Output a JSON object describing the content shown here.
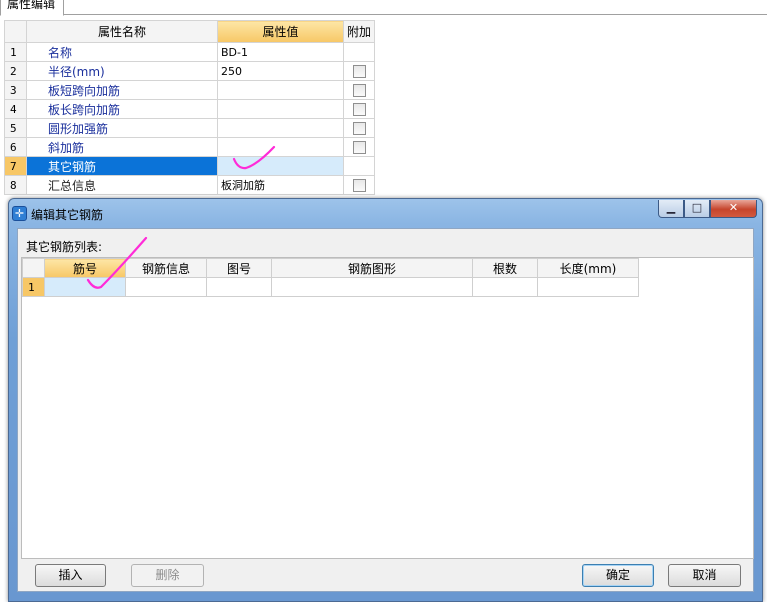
{
  "panel": {
    "tab_label": "属性编辑",
    "columns": {
      "name": "属性名称",
      "value": "属性值",
      "extra": "附加"
    },
    "rows": [
      {
        "num": "1",
        "name": "名称",
        "value": "BD-1",
        "has_check": false
      },
      {
        "num": "2",
        "name": "半径(mm)",
        "value": "250",
        "has_check": true
      },
      {
        "num": "3",
        "name": "板短跨向加筋",
        "value": "",
        "has_check": true
      },
      {
        "num": "4",
        "name": "板长跨向加筋",
        "value": "",
        "has_check": true
      },
      {
        "num": "5",
        "name": "圆形加强筋",
        "value": "",
        "has_check": true
      },
      {
        "num": "6",
        "name": "斜加筋",
        "value": "",
        "has_check": true
      },
      {
        "num": "7",
        "name": "其它钢筋",
        "value": "",
        "has_check": false,
        "selected": true
      },
      {
        "num": "8",
        "name": "汇总信息",
        "value": "板洞加筋",
        "has_check": true
      }
    ]
  },
  "dialog": {
    "title": "编辑其它钢筋",
    "list_label": "其它钢筋列表:",
    "columns": [
      "筋号",
      "钢筋信息",
      "图号",
      "钢筋图形",
      "根数",
      "长度(mm)"
    ],
    "rows": [
      {
        "num": "1",
        "cells": [
          "",
          "",
          "",
          "",
          "",
          ""
        ]
      }
    ],
    "buttons": {
      "insert": "插入",
      "delete": "删除",
      "ok": "确定",
      "cancel": "取消"
    },
    "window_controls": {
      "minimize": "▁",
      "maximize": "□",
      "close": "✕"
    },
    "icon": "plus-icon"
  },
  "colors": {
    "selection": "#0b73d8",
    "header_highlight": "#f7c766",
    "annotation": "#ff2bd8"
  }
}
